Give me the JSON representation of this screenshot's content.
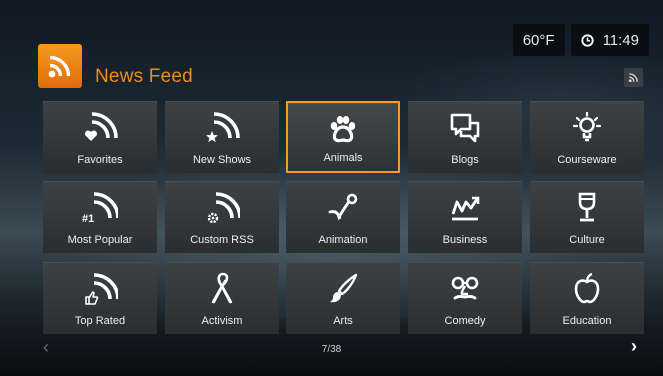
{
  "status": {
    "temperature": "60°F",
    "time": "11:49"
  },
  "header": {
    "title": "News Feed",
    "logo_icon": "rss-icon",
    "brand_color": "#f28a1c"
  },
  "tiles": [
    {
      "label": "Favorites",
      "icon": "rss-heart-icon"
    },
    {
      "label": "New Shows",
      "icon": "rss-star-icon"
    },
    {
      "label": "Animals",
      "icon": "paw-icon",
      "selected": true
    },
    {
      "label": "Blogs",
      "icon": "chat-bubbles-icon"
    },
    {
      "label": "Courseware",
      "icon": "lightbulb-icon"
    },
    {
      "label": "Most Popular",
      "icon": "rss-number-one-icon"
    },
    {
      "label": "Custom RSS",
      "icon": "rss-gear-icon"
    },
    {
      "label": "Animation",
      "icon": "animation-icon"
    },
    {
      "label": "Business",
      "icon": "business-chart-icon"
    },
    {
      "label": "Culture",
      "icon": "wine-glass-icon"
    },
    {
      "label": "Top Rated",
      "icon": "rss-thumbs-up-icon"
    },
    {
      "label": "Activism",
      "icon": "ribbon-icon"
    },
    {
      "label": "Arts",
      "icon": "paintbrush-icon"
    },
    {
      "label": "Comedy",
      "icon": "glasses-nose-icon"
    },
    {
      "label": "Education",
      "icon": "apple-icon"
    }
  ],
  "pagination": {
    "page": "7/38",
    "prev": "‹",
    "next": "›"
  }
}
